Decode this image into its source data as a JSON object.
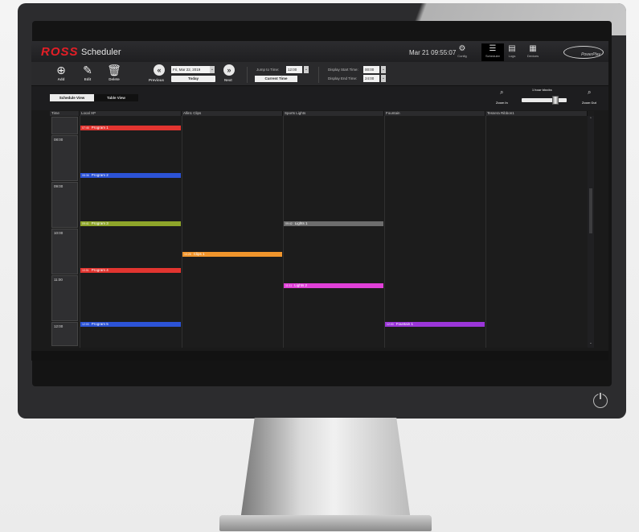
{
  "app": {
    "brand": "ROSS",
    "title": "Scheduler",
    "clock": "Mar 21 09:55:07",
    "product_logo": "PowerPlay"
  },
  "nav": [
    {
      "label": "Config",
      "icon": "gear-icon"
    },
    {
      "label": "Scheduler",
      "icon": "calendar-list-icon",
      "active": true
    },
    {
      "label": "Logs",
      "icon": "logs-icon"
    },
    {
      "label": "Devices",
      "icon": "devices-icon"
    }
  ],
  "toolbar": {
    "add_label": "Add",
    "edit_label": "Edit",
    "delete_label": "Delete",
    "previous_label": "Previous",
    "next_label": "Next",
    "date_value": "Fri, Mar 22, 2019",
    "today_label": "Today",
    "jump_label": "Jump to Time:",
    "jump_value": "12:00",
    "current_time_label": "Current Time",
    "display_start_label": "Display Start Time:",
    "display_start_value": "00:00",
    "display_end_label": "Display End Time:",
    "display_end_value": "24:00"
  },
  "views": {
    "schedule_label": "Schedule View",
    "table_label": "Table View"
  },
  "zoom": {
    "block_label": "1 hour blocks",
    "zoom_in_label": "Zoom In",
    "zoom_out_label": "Zoom Out"
  },
  "grid": {
    "columns": [
      "Time",
      "Local XP",
      "Allin1 Clips",
      "Sports Lights",
      "Fountain",
      "Tessera Ribbon1"
    ],
    "times": [
      "08:00",
      "09:00",
      "10:00",
      "11:00",
      "12:00"
    ],
    "events": [
      {
        "col": 1,
        "time": "07:46",
        "label": "Program 1",
        "color": "#e23530"
      },
      {
        "col": 1,
        "time": "08:36",
        "label": "Program 2",
        "color": "#2c53d6"
      },
      {
        "col": 1,
        "time": "09:41",
        "label": "Program 3",
        "color": "#8ea52a"
      },
      {
        "col": 3,
        "time": "09:42",
        "label": "Lights 1",
        "color": "#6d6d6d"
      },
      {
        "col": 2,
        "time": "10:28",
        "label": "Clips 1",
        "color": "#f0952c"
      },
      {
        "col": 1,
        "time": "10:51",
        "label": "Program 4",
        "color": "#e23530"
      },
      {
        "col": 3,
        "time": "11:11",
        "label": "Lights 2",
        "color": "#e040d8"
      },
      {
        "col": 1,
        "time": "12:00",
        "label": "Program 5",
        "color": "#2c53d6"
      },
      {
        "col": 4,
        "time": "12:00",
        "label": "Fountain 1",
        "color": "#9b36d8"
      }
    ]
  }
}
